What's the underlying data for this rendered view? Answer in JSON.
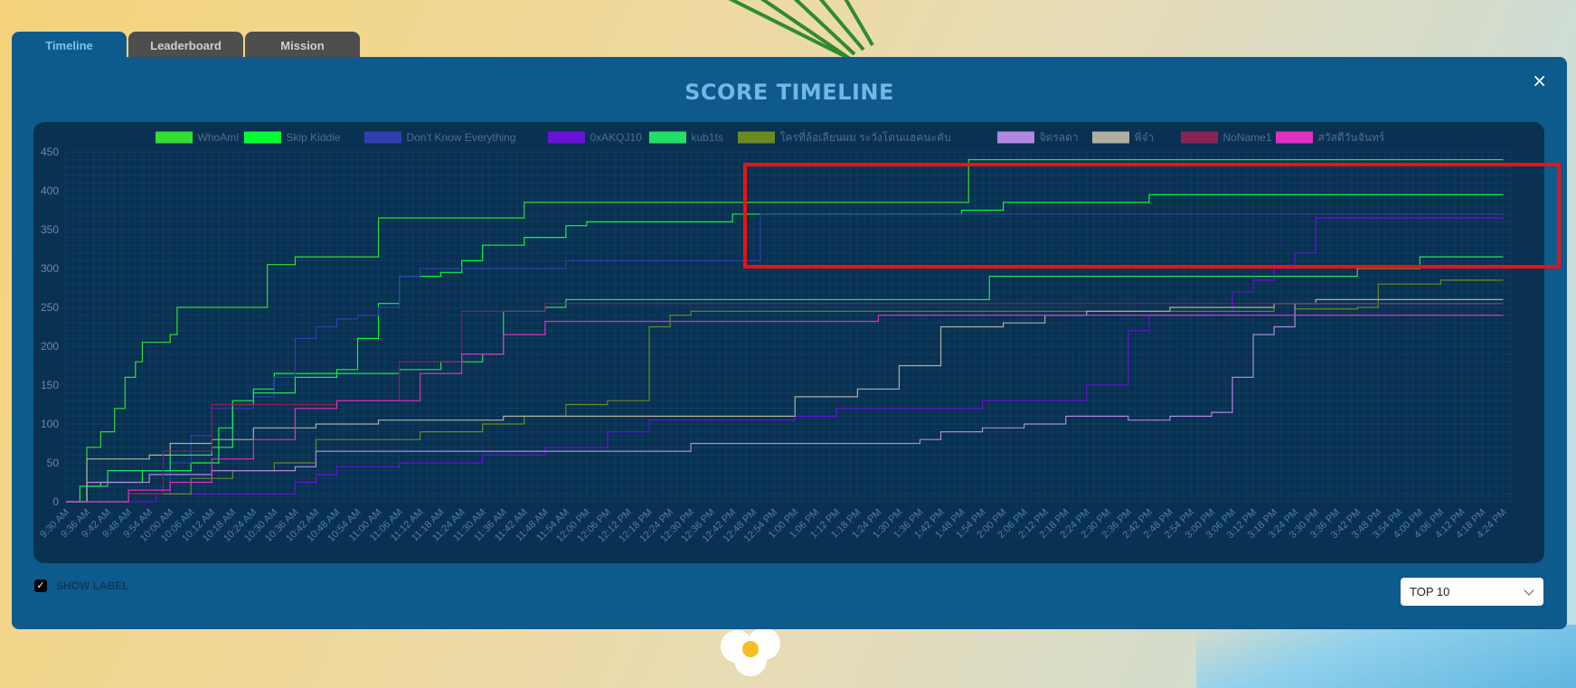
{
  "tabs": [
    {
      "label": "Timeline",
      "active": true
    },
    {
      "label": "Leaderboard",
      "active": false
    },
    {
      "label": "Mission",
      "active": false
    }
  ],
  "panel": {
    "title": "SCORE TIMELINE",
    "close_icon": "×",
    "show_labels": {
      "checked": true,
      "label": "SHOW LABEL"
    },
    "select": {
      "value": "TOP 10"
    }
  },
  "colors": {
    "panel_bg": "#0e5a8c",
    "chart_bg": "#093152",
    "highlight": "#ee1111"
  },
  "chart_data": {
    "type": "line",
    "title": "SCORE TIMELINE",
    "ylim": [
      0,
      450
    ],
    "y_ticks": [
      0,
      50,
      100,
      150,
      200,
      250,
      300,
      350,
      400,
      450
    ],
    "x_labels": [
      "9:30 AM",
      "9:36 AM",
      "9:42 AM",
      "9:48 AM",
      "9:54 AM",
      "10:00 AM",
      "10:06 AM",
      "10:12 AM",
      "10:18 AM",
      "10:24 AM",
      "10:30 AM",
      "10:36 AM",
      "10:42 AM",
      "10:48 AM",
      "10:54 AM",
      "11:00 AM",
      "11:06 AM",
      "11:12 AM",
      "11:18 AM",
      "11:24 AM",
      "11:30 AM",
      "11:36 AM",
      "11:42 AM",
      "11:48 AM",
      "11:54 AM",
      "12:00 PM",
      "12:06 PM",
      "12:12 PM",
      "12:18 PM",
      "12:24 PM",
      "12:30 PM",
      "12:36 PM",
      "12:42 PM",
      "12:48 PM",
      "12:54 PM",
      "1:00 PM",
      "1:06 PM",
      "1:12 PM",
      "1:18 PM",
      "1:24 PM",
      "1:30 PM",
      "1:36 PM",
      "1:42 PM",
      "1:48 PM",
      "1:54 PM",
      "2:00 PM",
      "2:06 PM",
      "2:12 PM",
      "2:18 PM",
      "2:24 PM",
      "2:30 PM",
      "2:36 PM",
      "2:42 PM",
      "2:48 PM",
      "2:54 PM",
      "3:00 PM",
      "3:06 PM",
      "3:12 PM",
      "3:18 PM",
      "3:24 PM",
      "3:30 PM",
      "3:36 PM",
      "3:42 PM",
      "3:48 PM",
      "3:54 PM",
      "4:00 PM",
      "4:06 PM",
      "4:12 PM",
      "4:18 PM",
      "4:24 PM"
    ],
    "grid": true,
    "legend_position": "top",
    "series": [
      {
        "name": "WhoAmI",
        "color": "#33dd33",
        "points": [
          [
            "9:30 AM",
            0
          ],
          [
            "9:36 AM",
            70
          ],
          [
            "9:40 AM",
            90
          ],
          [
            "9:44 AM",
            120
          ],
          [
            "9:47 AM",
            160
          ],
          [
            "9:50 AM",
            180
          ],
          [
            "9:52 AM",
            205
          ],
          [
            "10:00 AM",
            215
          ],
          [
            "10:02 AM",
            250
          ],
          [
            "10:24 AM",
            250
          ],
          [
            "10:28 AM",
            305
          ],
          [
            "10:36 AM",
            315
          ],
          [
            "10:54 AM",
            315
          ],
          [
            "11:00 AM",
            365
          ],
          [
            "11:36 AM",
            365
          ],
          [
            "11:42 AM",
            385
          ],
          [
            "12:42 PM",
            385
          ],
          [
            "12:46 PM",
            385
          ],
          [
            "1:48 PM",
            385
          ],
          [
            "1:50 PM",
            440
          ],
          [
            "4:24 PM",
            440
          ]
        ]
      },
      {
        "name": "Skip Kiddie",
        "color": "#00ff33",
        "points": [
          [
            "9:30 AM",
            0
          ],
          [
            "9:34 AM",
            20
          ],
          [
            "9:40 AM",
            25
          ],
          [
            "9:48 AM",
            25
          ],
          [
            "9:52 AM",
            40
          ],
          [
            "10:06 AM",
            50
          ],
          [
            "10:14 AM",
            95
          ],
          [
            "10:18 AM",
            130
          ],
          [
            "10:24 AM",
            145
          ],
          [
            "10:30 AM",
            165
          ],
          [
            "10:48 AM",
            170
          ],
          [
            "10:54 AM",
            210
          ],
          [
            "11:00 AM",
            255
          ],
          [
            "11:06 AM",
            290
          ],
          [
            "11:18 AM",
            295
          ],
          [
            "11:24 AM",
            310
          ],
          [
            "11:30 AM",
            330
          ],
          [
            "11:42 AM",
            340
          ],
          [
            "11:54 AM",
            355
          ],
          [
            "12:00 PM",
            360
          ],
          [
            "12:30 PM",
            360
          ],
          [
            "12:42 PM",
            370
          ],
          [
            "1:48 PM",
            375
          ],
          [
            "2:00 PM",
            385
          ],
          [
            "2:36 PM",
            385
          ],
          [
            "2:42 PM",
            395
          ],
          [
            "4:24 PM",
            395
          ]
        ]
      },
      {
        "name": "Don't Know Everything",
        "color": "#3040b0",
        "points": [
          [
            "9:30 AM",
            0
          ],
          [
            "9:42 AM",
            0
          ],
          [
            "9:48 AM",
            10
          ],
          [
            "10:00 AM",
            50
          ],
          [
            "10:06 AM",
            85
          ],
          [
            "10:12 AM",
            120
          ],
          [
            "10:18 AM",
            120
          ],
          [
            "10:24 AM",
            135
          ],
          [
            "10:30 AM",
            160
          ],
          [
            "10:36 AM",
            210
          ],
          [
            "10:42 AM",
            225
          ],
          [
            "10:48 AM",
            235
          ],
          [
            "10:54 AM",
            240
          ],
          [
            "11:00 AM",
            250
          ],
          [
            "11:06 AM",
            290
          ],
          [
            "11:12 AM",
            300
          ],
          [
            "11:48 AM",
            300
          ],
          [
            "11:54 AM",
            310
          ],
          [
            "12:36 PM",
            310
          ],
          [
            "12:50 PM",
            370
          ],
          [
            "4:24 PM",
            370
          ]
        ]
      },
      {
        "name": "0xAKQJ10",
        "color": "#6a11d8",
        "points": [
          [
            "9:30 AM",
            0
          ],
          [
            "9:54 AM",
            0
          ],
          [
            "9:56 AM",
            10
          ],
          [
            "10:30 AM",
            10
          ],
          [
            "10:36 AM",
            25
          ],
          [
            "10:42 AM",
            35
          ],
          [
            "10:48 AM",
            45
          ],
          [
            "11:06 AM",
            50
          ],
          [
            "11:24 AM",
            50
          ],
          [
            "11:30 AM",
            60
          ],
          [
            "11:48 AM",
            70
          ],
          [
            "12:06 PM",
            90
          ],
          [
            "12:18 PM",
            105
          ],
          [
            "12:54 PM",
            105
          ],
          [
            "1:00 PM",
            110
          ],
          [
            "1:12 PM",
            120
          ],
          [
            "1:48 PM",
            120
          ],
          [
            "1:54 PM",
            130
          ],
          [
            "2:24 PM",
            150
          ],
          [
            "2:36 PM",
            220
          ],
          [
            "2:42 PM",
            240
          ],
          [
            "3:00 PM",
            245
          ],
          [
            "3:06 PM",
            270
          ],
          [
            "3:12 PM",
            285
          ],
          [
            "3:18 PM",
            300
          ],
          [
            "3:24 PM",
            320
          ],
          [
            "3:30 PM",
            365
          ],
          [
            "4:24 PM",
            365
          ]
        ]
      },
      {
        "name": "kub1ts",
        "color": "#22e066",
        "points": [
          [
            "9:30 AM",
            0
          ],
          [
            "9:36 AM",
            20
          ],
          [
            "9:42 AM",
            40
          ],
          [
            "10:00 AM",
            60
          ],
          [
            "10:12 AM",
            70
          ],
          [
            "10:18 AM",
            125
          ],
          [
            "10:24 AM",
            140
          ],
          [
            "10:36 AM",
            160
          ],
          [
            "10:48 AM",
            165
          ],
          [
            "11:06 AM",
            170
          ],
          [
            "11:18 AM",
            180
          ],
          [
            "11:30 AM",
            190
          ],
          [
            "11:36 AM",
            245
          ],
          [
            "11:48 AM",
            250
          ],
          [
            "11:54 AM",
            260
          ],
          [
            "1:54 PM",
            260
          ],
          [
            "1:56 PM",
            290
          ],
          [
            "3:18 PM",
            290
          ],
          [
            "3:30 PM",
            290
          ],
          [
            "3:42 PM",
            300
          ],
          [
            "4:00 PM",
            315
          ],
          [
            "4:24 PM",
            315
          ]
        ]
      },
      {
        "name": "ใครที่ล้อเลียนผม ระวังโดนแฮคนะคับ",
        "color": "#6a8a22",
        "points": [
          [
            "9:30 AM",
            0
          ],
          [
            "9:48 AM",
            10
          ],
          [
            "10:06 AM",
            30
          ],
          [
            "10:18 AM",
            40
          ],
          [
            "10:30 AM",
            50
          ],
          [
            "10:42 AM",
            80
          ],
          [
            "11:12 AM",
            90
          ],
          [
            "11:30 AM",
            100
          ],
          [
            "11:42 AM",
            110
          ],
          [
            "11:54 AM",
            125
          ],
          [
            "12:06 PM",
            130
          ],
          [
            "12:18 PM",
            225
          ],
          [
            "12:24 PM",
            240
          ],
          [
            "12:30 PM",
            245
          ],
          [
            "2:12 PM",
            245
          ],
          [
            "3:18 PM",
            255
          ],
          [
            "3:24 PM",
            248
          ],
          [
            "3:42 PM",
            250
          ],
          [
            "3:48 PM",
            280
          ],
          [
            "4:06 PM",
            285
          ],
          [
            "4:24 PM",
            285
          ]
        ]
      },
      {
        "name": "จิตรลดา",
        "color": "#b088e0",
        "points": [
          [
            "9:30 AM",
            0
          ],
          [
            "9:36 AM",
            25
          ],
          [
            "9:48 AM",
            25
          ],
          [
            "9:54 AM",
            35
          ],
          [
            "10:12 AM",
            40
          ],
          [
            "10:24 AM",
            40
          ],
          [
            "10:36 AM",
            45
          ],
          [
            "10:42 AM",
            65
          ],
          [
            "12:24 PM",
            65
          ],
          [
            "12:30 PM",
            75
          ],
          [
            "1:36 PM",
            80
          ],
          [
            "1:42 PM",
            90
          ],
          [
            "1:54 PM",
            95
          ],
          [
            "2:06 PM",
            100
          ],
          [
            "2:18 PM",
            110
          ],
          [
            "2:36 PM",
            105
          ],
          [
            "2:48 PM",
            110
          ],
          [
            "3:00 PM",
            115
          ],
          [
            "3:06 PM",
            160
          ],
          [
            "3:12 PM",
            215
          ],
          [
            "3:18 PM",
            225
          ],
          [
            "3:24 PM",
            255
          ],
          [
            "4:24 PM",
            255
          ]
        ]
      },
      {
        "name": "พี่จ๋า",
        "color": "#b0b0a0",
        "points": [
          [
            "9:30 AM",
            0
          ],
          [
            "9:36 AM",
            55
          ],
          [
            "9:54 AM",
            60
          ],
          [
            "10:00 AM",
            75
          ],
          [
            "10:12 AM",
            80
          ],
          [
            "10:24 AM",
            95
          ],
          [
            "10:42 AM",
            100
          ],
          [
            "11:00 AM",
            105
          ],
          [
            "11:30 AM",
            105
          ],
          [
            "11:36 AM",
            110
          ],
          [
            "12:54 PM",
            110
          ],
          [
            "1:00 PM",
            135
          ],
          [
            "1:18 PM",
            145
          ],
          [
            "1:30 PM",
            175
          ],
          [
            "1:42 PM",
            225
          ],
          [
            "2:00 PM",
            230
          ],
          [
            "2:12 PM",
            240
          ],
          [
            "2:24 PM",
            245
          ],
          [
            "2:48 PM",
            250
          ],
          [
            "3:18 PM",
            255
          ],
          [
            "3:30 PM",
            260
          ],
          [
            "4:24 PM",
            260
          ]
        ]
      },
      {
        "name": "NoName1",
        "color": "#8a2255",
        "points": [
          [
            "9:30 AM",
            0
          ],
          [
            "9:48 AM",
            10
          ],
          [
            "9:58 AM",
            65
          ],
          [
            "10:12 AM",
            125
          ],
          [
            "10:24 AM",
            125
          ],
          [
            "10:36 AM",
            125
          ],
          [
            "10:48 AM",
            130
          ],
          [
            "11:00 AM",
            130
          ],
          [
            "11:06 AM",
            180
          ],
          [
            "11:24 AM",
            245
          ],
          [
            "11:36 AM",
            245
          ],
          [
            "11:48 AM",
            255
          ],
          [
            "4:24 PM",
            255
          ]
        ]
      },
      {
        "name": "สวัสดีวันจันทร์",
        "color": "#e030c0",
        "points": [
          [
            "9:30 AM",
            0
          ],
          [
            "9:48 AM",
            15
          ],
          [
            "10:00 AM",
            25
          ],
          [
            "10:12 AM",
            55
          ],
          [
            "10:24 AM",
            80
          ],
          [
            "10:36 AM",
            120
          ],
          [
            "10:48 AM",
            130
          ],
          [
            "11:06 AM",
            130
          ],
          [
            "11:12 AM",
            165
          ],
          [
            "11:24 AM",
            190
          ],
          [
            "11:36 AM",
            215
          ],
          [
            "11:48 AM",
            232
          ],
          [
            "1:12 PM",
            232
          ],
          [
            "1:24 PM",
            240
          ],
          [
            "4:24 PM",
            240
          ]
        ]
      }
    ]
  }
}
